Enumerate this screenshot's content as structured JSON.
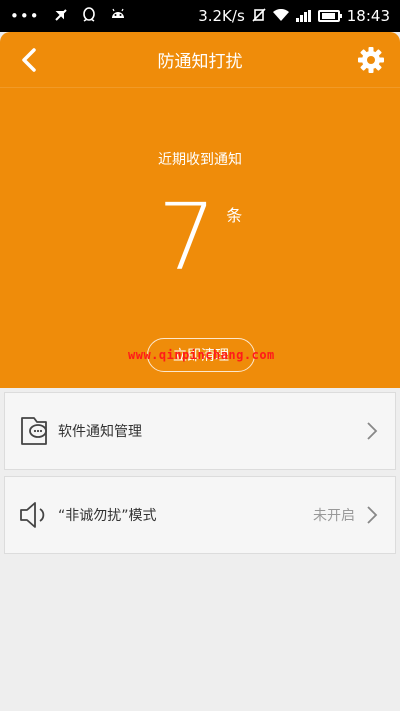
{
  "status_bar": {
    "dots": "•••",
    "speed": "3.2K/s",
    "time": "18:43",
    "icons": [
      "notification-dots-icon",
      "mute-icon",
      "qq-icon",
      "android-icon",
      "vibrate-off-icon",
      "wifi-icon",
      "signal-icon",
      "battery-icon"
    ]
  },
  "header": {
    "title": "防通知打扰",
    "back_icon": "back-arrow-icon",
    "settings_icon": "gear-icon"
  },
  "summary": {
    "label": "近期收到通知",
    "count": "7",
    "unit": "条",
    "button_label": "立即清理"
  },
  "watermark": "www.qinpinchang.com",
  "list": {
    "items": [
      {
        "icon": "app-notification-icon",
        "label": "软件通知管理",
        "status": ""
      },
      {
        "icon": "speaker-icon",
        "label": "“非诚勿扰”模式",
        "status": "未开启"
      }
    ]
  },
  "colors": {
    "accent": "#ef8c0a",
    "background": "#eeeeee",
    "list_item_bg": "#f6f6f6"
  }
}
